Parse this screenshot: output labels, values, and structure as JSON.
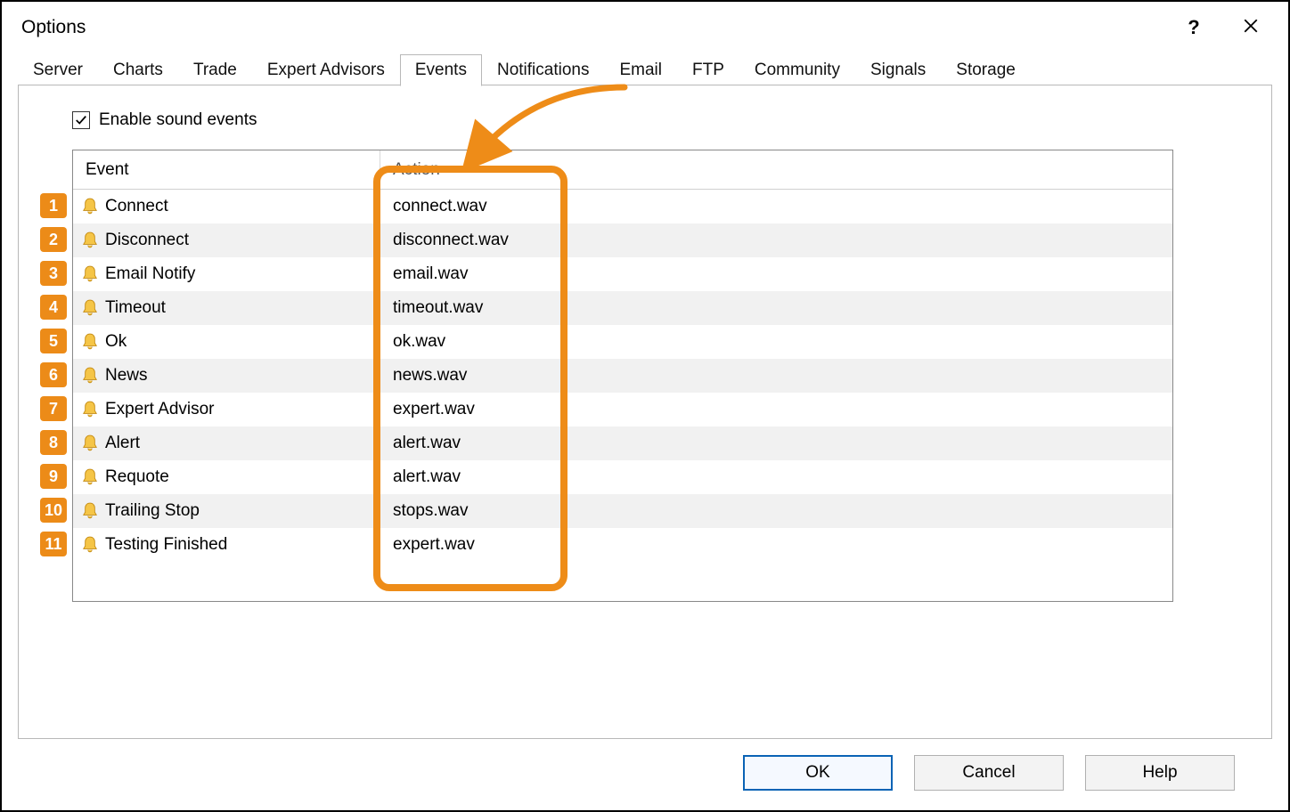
{
  "window": {
    "title": "Options"
  },
  "tabs": [
    {
      "label": "Server",
      "active": false
    },
    {
      "label": "Charts",
      "active": false
    },
    {
      "label": "Trade",
      "active": false
    },
    {
      "label": "Expert Advisors",
      "active": false
    },
    {
      "label": "Events",
      "active": true
    },
    {
      "label": "Notifications",
      "active": false
    },
    {
      "label": "Email",
      "active": false
    },
    {
      "label": "FTP",
      "active": false
    },
    {
      "label": "Community",
      "active": false
    },
    {
      "label": "Signals",
      "active": false
    },
    {
      "label": "Storage",
      "active": false
    }
  ],
  "events_panel": {
    "enable_label": "Enable sound events",
    "enable_checked": true,
    "columns": {
      "event": "Event",
      "action": "Action"
    },
    "rows": [
      {
        "num": "1",
        "event": "Connect",
        "action": "connect.wav"
      },
      {
        "num": "2",
        "event": "Disconnect",
        "action": "disconnect.wav"
      },
      {
        "num": "3",
        "event": "Email Notify",
        "action": "email.wav"
      },
      {
        "num": "4",
        "event": "Timeout",
        "action": "timeout.wav"
      },
      {
        "num": "5",
        "event": "Ok",
        "action": "ok.wav"
      },
      {
        "num": "6",
        "event": "News",
        "action": "news.wav"
      },
      {
        "num": "7",
        "event": "Expert Advisor",
        "action": "expert.wav"
      },
      {
        "num": "8",
        "event": "Alert",
        "action": "alert.wav"
      },
      {
        "num": "9",
        "event": "Requote",
        "action": "alert.wav"
      },
      {
        "num": "10",
        "event": "Trailing Stop",
        "action": "stops.wav"
      },
      {
        "num": "11",
        "event": "Testing Finished",
        "action": "expert.wav"
      }
    ]
  },
  "buttons": {
    "ok": "OK",
    "cancel": "Cancel",
    "help": "Help"
  },
  "annotation": {
    "highlight_action_column": true
  }
}
